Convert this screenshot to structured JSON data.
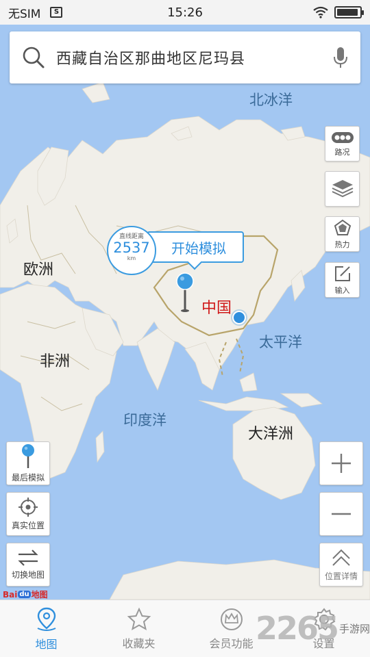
{
  "status_bar": {
    "carrier": "无SIM",
    "time": "15:26",
    "sim_icon": "sim-card-icon",
    "battery_level": 0.95
  },
  "search": {
    "query": "西藏自治区那曲地区尼玛县",
    "search_icon": "search-icon",
    "voice_icon": "microphone-icon"
  },
  "map_labels": {
    "arctic_ocean": "北冰洋",
    "europe": "欧洲",
    "china": "中国",
    "pacific_ocean": "太平洋",
    "africa": "非洲",
    "indian_ocean": "印度洋",
    "oceania": "大洋洲"
  },
  "callout": {
    "distance_title": "直线距离",
    "distance_value": "2537",
    "distance_unit": "km",
    "start_label": "开始模拟"
  },
  "right_controls": {
    "traffic": "路况",
    "heat": "热力",
    "input": "输入",
    "location_details": "位置详情"
  },
  "left_controls": {
    "last_sim": "最后模拟",
    "real_location": "真实位置",
    "switch_map": "切换地图"
  },
  "baidu_logo": {
    "bai": "Bai",
    "du": "du",
    "map": "地图"
  },
  "tabs": [
    {
      "label": "地图",
      "icon": "map-pin-icon",
      "active": true
    },
    {
      "label": "收藏夹",
      "icon": "star-icon",
      "active": false
    },
    {
      "label": "会员功能",
      "icon": "crown-icon",
      "active": false
    },
    {
      "label": "设置",
      "icon": "gear-icon",
      "active": false
    }
  ],
  "watermark": {
    "number": "2265",
    "text": "手游网"
  },
  "colors": {
    "accent": "#2f8fdd",
    "ocean": "#a3c7f2",
    "land": "#f1efe9",
    "border": "#b8a46a",
    "china_label": "#d01818"
  }
}
